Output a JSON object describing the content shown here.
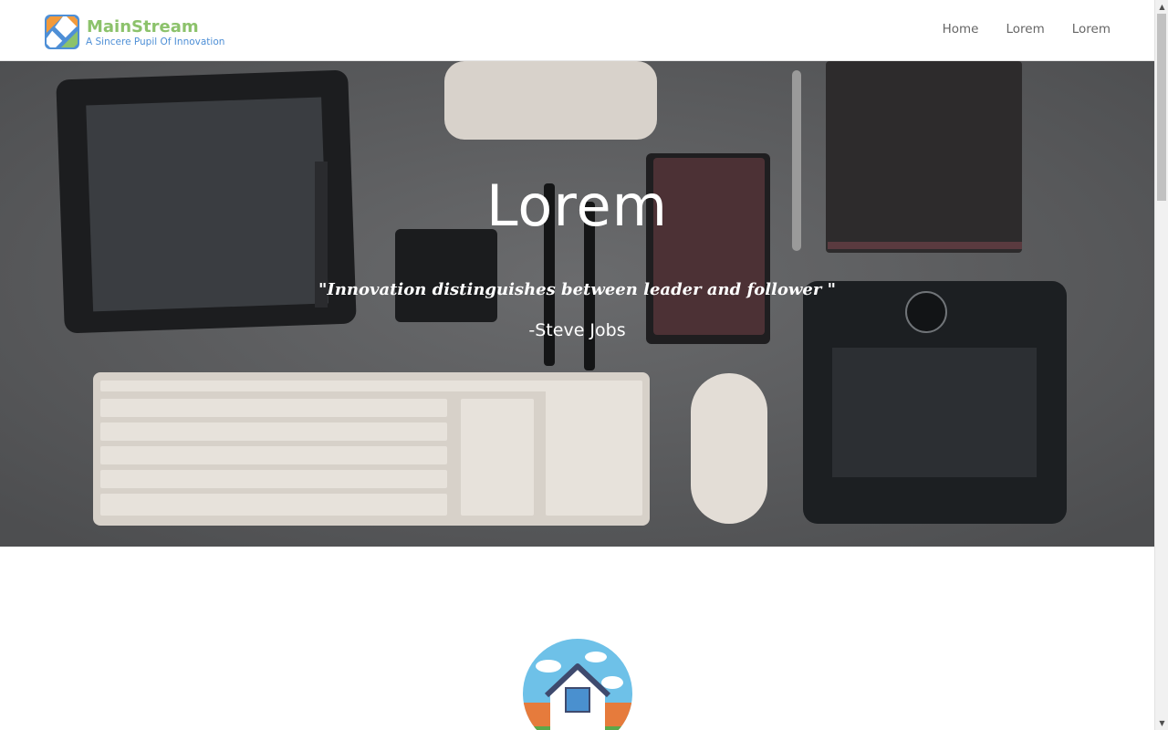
{
  "header": {
    "brand_name": "MainStream",
    "brand_tagline": "A Sincere Pupil Of Innovation",
    "nav": [
      {
        "label": "Home"
      },
      {
        "label": "Lorem"
      },
      {
        "label": "Lorem"
      }
    ]
  },
  "hero": {
    "title": "Lorem",
    "quote": "\"Innovation distinguishes between leader and follower \"",
    "author": "-Steve Jobs"
  },
  "icons": {
    "logo": "mainstream-logo",
    "feature": "house-icon"
  },
  "colors": {
    "brand_green": "#8cc26b",
    "brand_blue": "#4e8fd6",
    "nav_text": "#666666",
    "hero_bg": "#5b5c5e"
  }
}
